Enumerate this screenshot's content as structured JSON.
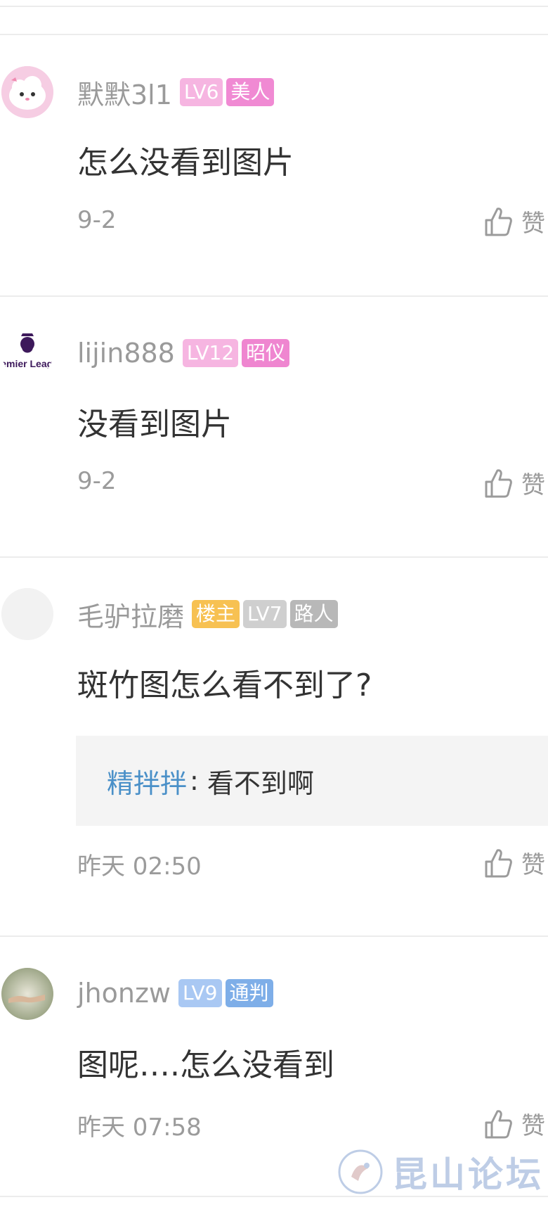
{
  "comments": [
    {
      "username": "默默3l1",
      "badges": [
        {
          "text": "LV6",
          "color": "#f6b5e1"
        },
        {
          "text": "美人",
          "color": "#f08ad3"
        }
      ],
      "text": "怎么没看到图片",
      "time": "9-2",
      "like_label": "赞",
      "avatar_icon": "cute-cloud-avatar"
    },
    {
      "username": "lijin888",
      "badges": [
        {
          "text": "LV12",
          "color": "#f6b5e1"
        },
        {
          "text": "昭仪",
          "color": "#ef86d0"
        }
      ],
      "text": "没看到图片",
      "time": "9-2",
      "like_label": "赞",
      "avatar_icon": "premier-league-logo",
      "avatar_logo_text": "Premier League"
    },
    {
      "username": "毛驴拉磨",
      "badges": [
        {
          "text": "楼主",
          "color": "#f7c152"
        },
        {
          "text": "LV7",
          "color": "#cfcfcf"
        },
        {
          "text": "路人",
          "color": "#b8b8b8"
        }
      ],
      "text": "斑竹图怎么看不到了?",
      "reply": {
        "user": "精拌拌",
        "separator": ":",
        "text": "看不到啊"
      },
      "time": "昨天 02:50",
      "like_label": "赞",
      "avatar_icon": "blank-avatar"
    },
    {
      "username": "jhonzw",
      "badges": [
        {
          "text": "LV9",
          "color": "#a9c8f3"
        },
        {
          "text": "通判",
          "color": "#7eaee8"
        }
      ],
      "text": "图呢….怎么没看到",
      "time": "昨天 07:58",
      "like_label": "赞",
      "avatar_icon": "photo-hands-avatar"
    }
  ],
  "watermark": {
    "text": "昆山论坛",
    "icon": "kunshan-forum-logo-icon"
  },
  "colors": {
    "accent_link": "#4a90c8",
    "divider": "#ececec",
    "quote_bg": "#f4f4f4"
  }
}
